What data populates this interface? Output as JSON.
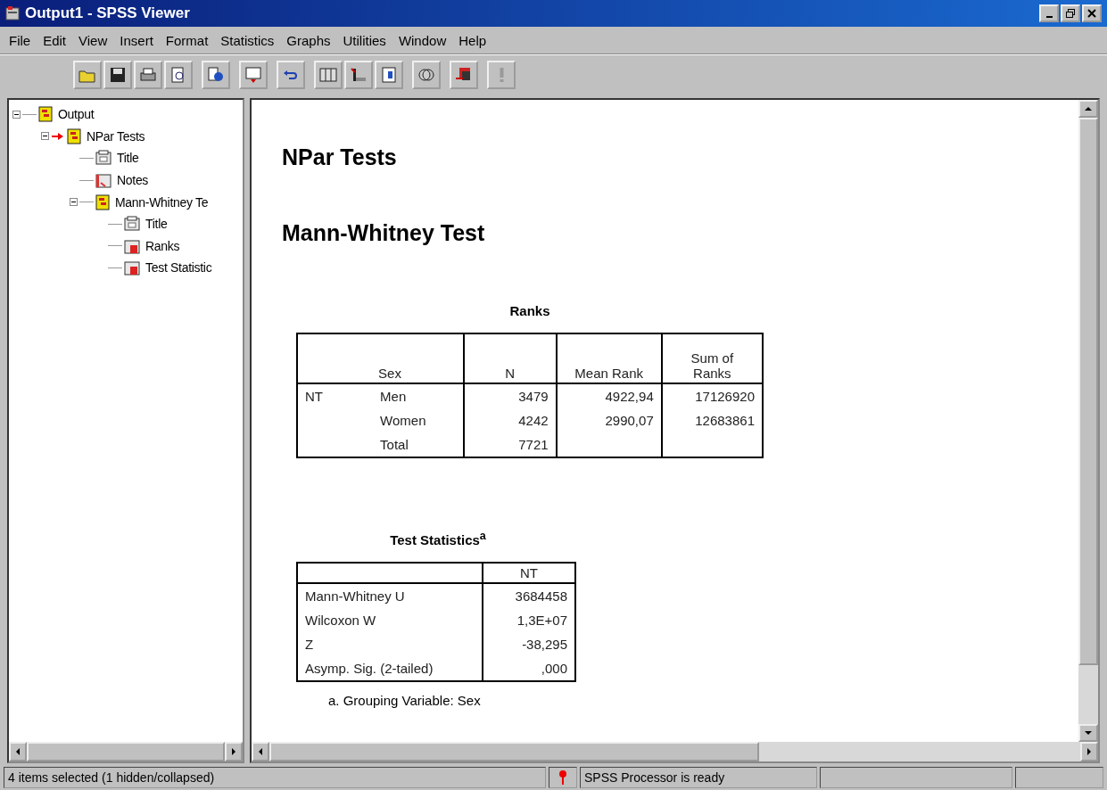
{
  "window": {
    "title": "Output1 - SPSS Viewer"
  },
  "menu": [
    "File",
    "Edit",
    "View",
    "Insert",
    "Format",
    "Statistics",
    "Graphs",
    "Utilities",
    "Window",
    "Help"
  ],
  "outline": [
    {
      "label": "Output",
      "kind": "book",
      "expanded": true,
      "current": false,
      "children": [
        {
          "label": "NPar Tests",
          "kind": "book",
          "expanded": true,
          "current": true,
          "children": [
            {
              "label": "Title",
              "kind": "title",
              "current": false
            },
            {
              "label": "Notes",
              "kind": "notes",
              "current": false
            },
            {
              "label": "Mann-Whitney Te",
              "kind": "book",
              "expanded": true,
              "current": false,
              "children": [
                {
                  "label": "Title",
                  "kind": "title",
                  "current": false
                },
                {
                  "label": "Ranks",
                  "kind": "table",
                  "current": false
                },
                {
                  "label": "Test Statistic",
                  "kind": "table",
                  "current": false
                }
              ]
            }
          ]
        }
      ]
    }
  ],
  "viewer": {
    "headings": [
      "NPar Tests",
      "Mann-Whitney Test"
    ],
    "ranks": {
      "title": "Ranks",
      "columns": [
        "Sex",
        "N",
        "Mean Rank",
        "Sum of Ranks"
      ],
      "rows": [
        {
          "variable": "NT",
          "group": "Men",
          "n": "3479",
          "mean_rank": "4922,94",
          "sum_of_ranks": "17126920"
        },
        {
          "group": "Women",
          "n": "4242",
          "mean_rank": "2990,07",
          "sum_of_ranks": "12683861"
        },
        {
          "group": "Total",
          "n": "7721"
        }
      ]
    },
    "test_statistics": {
      "title": "Test Statistics$^{a}$",
      "column": "NT",
      "rows": [
        {
          "label": "Mann-Whitney U",
          "value": "3684458"
        },
        {
          "label": "Wilcoxon W",
          "value": "1,3E+07"
        },
        {
          "label": "Z",
          "value": "-38,295"
        },
        {
          "label": "Asymp. Sig. (2-tailed)",
          "value": ",000"
        }
      ],
      "footnote": "a. Grouping Variable: Sex"
    }
  },
  "status_bar": {
    "selection": "4 items selected (1 hidden/collapsed)",
    "processor": "SPSS Processor is ready"
  }
}
